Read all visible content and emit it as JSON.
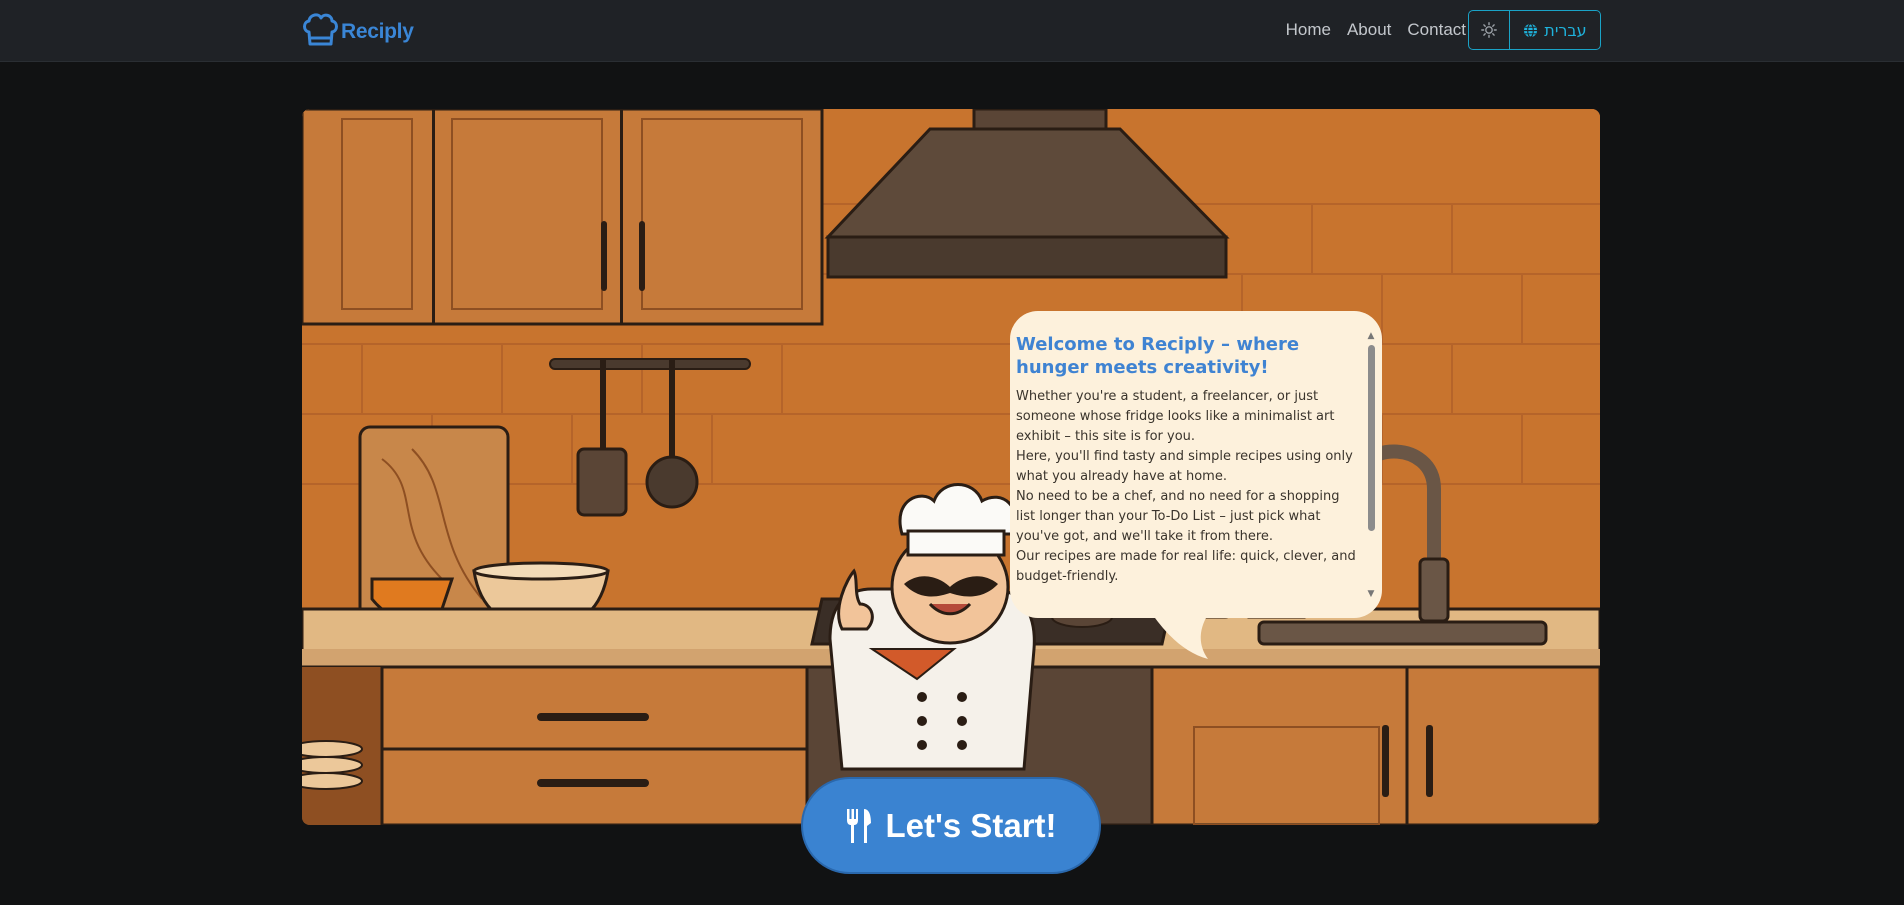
{
  "brand": {
    "name": "Reciply",
    "logo_icon": "chef-hat-icon",
    "color": "#3a86d6"
  },
  "nav": {
    "links": [
      "Home",
      "About",
      "Contact"
    ]
  },
  "controls": {
    "theme_icon": "sun-icon",
    "language_icon": "globe-icon",
    "language_label": "עברית",
    "accent": "#1aa3c7"
  },
  "hero": {
    "image": "kitchen-chef-illustration",
    "bubble": {
      "title": "Welcome to Reciply – where hunger meets creativity!",
      "paragraphs": [
        "Whether you're a student, a freelancer, or just someone whose fridge looks like a minimalist art exhibit – this site is for you.",
        "Here, you'll find tasty and simple recipes using only what you already have at home.",
        "No need to be a chef, and no need for a shopping list longer than your To-Do List – just pick what you've got, and we'll take it from there.",
        "Our recipes are made for real life: quick, clever, and budget-friendly."
      ]
    },
    "cta": {
      "label": "Let's Start!",
      "icon": "utensils-icon",
      "color": "#3a83d1"
    }
  }
}
